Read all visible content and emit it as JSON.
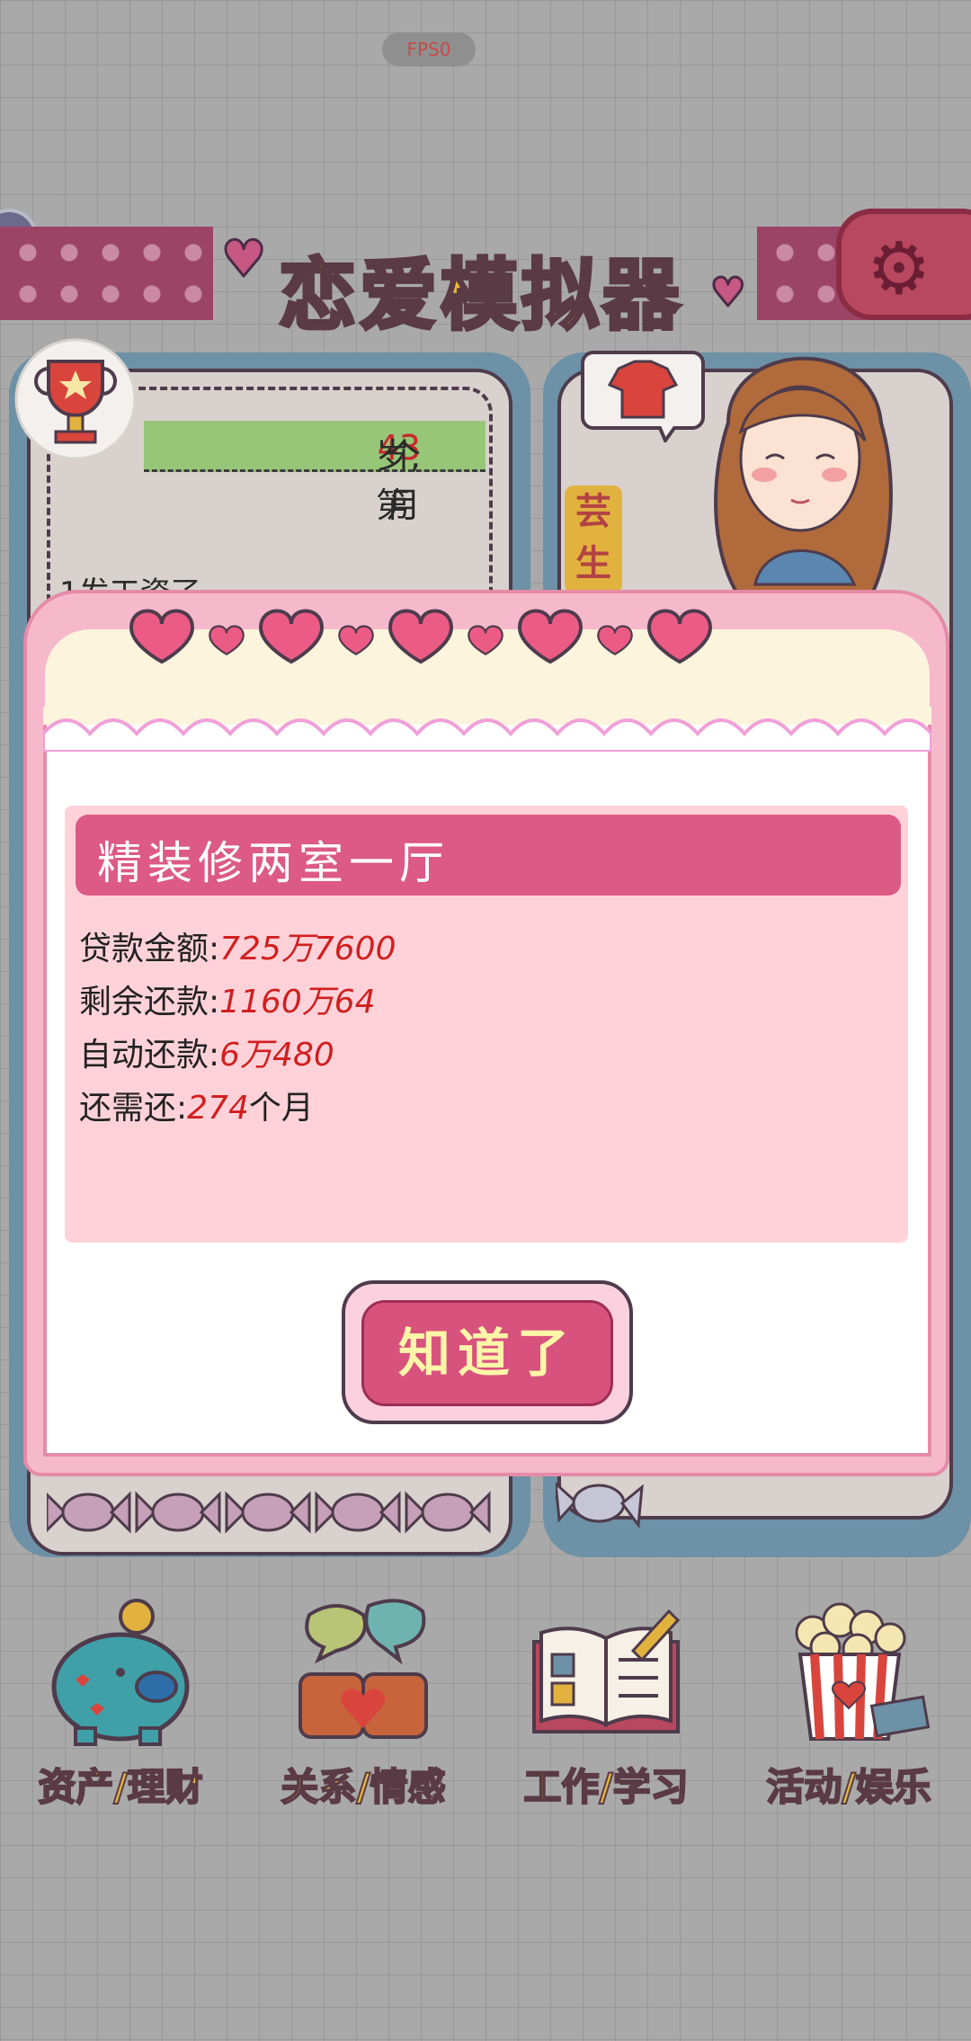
{
  "fps": "FPS0",
  "title": "恋爱模拟器",
  "status": {
    "age_num": "43",
    "age_unit": "岁,第",
    "month_num": "3",
    "month_unit": "个月",
    "salary_text": "1发工资了"
  },
  "character": {
    "name": "芸生"
  },
  "dialog": {
    "heading": "精装修两室一厅",
    "rows": [
      {
        "label": "贷款金额:",
        "value": "725万7600",
        "suffix": ""
      },
      {
        "label": "剩余还款:",
        "value": "1160万64",
        "suffix": ""
      },
      {
        "label": "自动还款:",
        "value": "6万480",
        "suffix": ""
      },
      {
        "label": "还需还:",
        "value": "274",
        "suffix": "个月"
      }
    ],
    "confirm_label": "知道了"
  },
  "nav": [
    {
      "label": "资产/理财",
      "icon": "piggy-bank-icon"
    },
    {
      "label": "关系/情感",
      "icon": "couple-mugs-icon"
    },
    {
      "label": "工作/学习",
      "icon": "open-book-icon"
    },
    {
      "label": "活动/娱乐",
      "icon": "popcorn-icon"
    }
  ],
  "colors": {
    "dialog_header": "#dc5a85",
    "value_red": "#d11f1f",
    "title_yellow": "#e9b93a",
    "panel_blue": "#6d91a6"
  }
}
